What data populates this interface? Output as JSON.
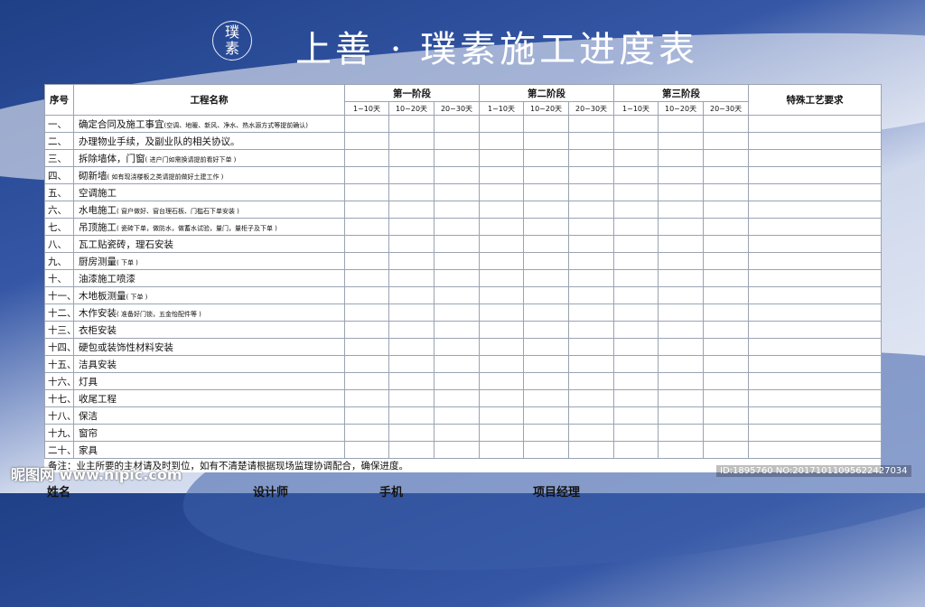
{
  "title": "上善 · 璞素施工进度表",
  "logo": {
    "top": "璞",
    "bottom": "素"
  },
  "headers": {
    "seq": "序号",
    "name": "工程名称",
    "special": "特殊工艺要求",
    "phases": [
      "第一阶段",
      "第二阶段",
      "第三阶段"
    ],
    "sub": [
      "1~10天",
      "10~20天",
      "20~30天"
    ]
  },
  "rows": [
    {
      "num": "一、",
      "name": "确定合同及施工事宜",
      "note": "(空调、地暖、新风、净水、热水源方式等提前确认)"
    },
    {
      "num": "二、",
      "name": "办理物业手续，及副业队的相关协议。",
      "note": ""
    },
    {
      "num": "三、",
      "name": "拆除墙体，门窗",
      "note": "( 进户门如需换请提前看好下单 )"
    },
    {
      "num": "四、",
      "name": "砌新墙",
      "note": "( 如有现浇楼板之类请提前做好土建工作 )"
    },
    {
      "num": "五、",
      "name": "空调施工",
      "note": ""
    },
    {
      "num": "六、",
      "name": "水电施工",
      "note": "( 窗户做好、窗台理石板、门槛石下单安装 )"
    },
    {
      "num": "七、",
      "name": "吊顶施工",
      "note": "( 瓷砖下单，做防水，做蓄水试验，量门，量柜子及下单 )"
    },
    {
      "num": "八、",
      "name": "瓦工贴瓷砖，理石安装",
      "note": ""
    },
    {
      "num": "九、",
      "name": "厨房测量",
      "note": "( 下单 )"
    },
    {
      "num": "十、",
      "name": "油漆施工喷漆",
      "note": ""
    },
    {
      "num": "十一、",
      "name": "木地板测量",
      "note": "( 下单 )"
    },
    {
      "num": "十二、",
      "name": "木作安装",
      "note": "( 准备好门锁，五金怡配件等 )"
    },
    {
      "num": "十三、",
      "name": "衣柜安装",
      "note": ""
    },
    {
      "num": "十四、",
      "name": "硬包或装饰性材料安装",
      "note": ""
    },
    {
      "num": "十五、",
      "name": "洁具安装",
      "note": ""
    },
    {
      "num": "十六、",
      "name": "灯具",
      "note": ""
    },
    {
      "num": "十七、",
      "name": "收尾工程",
      "note": ""
    },
    {
      "num": "十八、",
      "name": "保洁",
      "note": ""
    },
    {
      "num": "十九、",
      "name": "窗帘",
      "note": ""
    },
    {
      "num": "二十、",
      "name": "家具",
      "note": ""
    }
  ],
  "remark": "备注：业主所要的主材请及时到位，如有不清楚请根据现场监理协调配合，确保进度。",
  "footer": {
    "owner": "姓名",
    "designer": "设计师",
    "phone": "手机",
    "manager": "项目经理"
  },
  "watermark": {
    "left": "昵图网 www.nipic.com",
    "right": "ID:1895760 NO:20171011095622427034"
  }
}
